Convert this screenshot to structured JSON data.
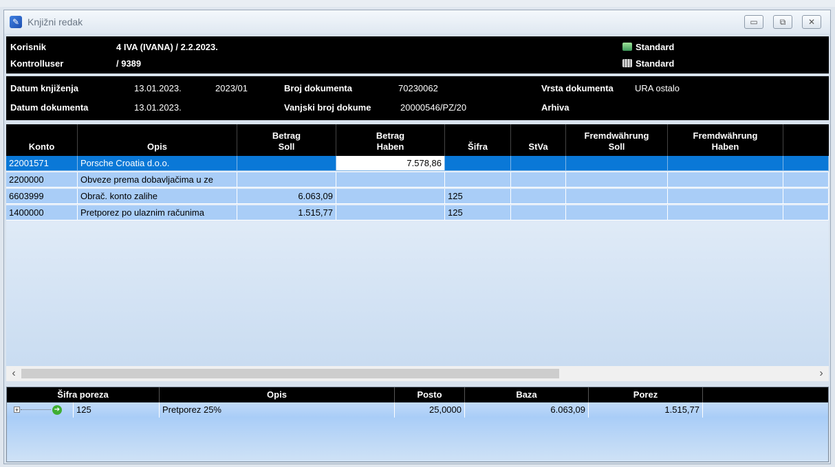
{
  "window": {
    "title": "Knjižni redak"
  },
  "header": {
    "korisnik_label": "Korisnik",
    "korisnik_value": "4 IVA (IVANA)  / 2.2.2023.",
    "kontroll_label": "Kontrolluser",
    "kontroll_value": "/ 9389",
    "standard1": "Standard",
    "standard2": "Standard",
    "datum_knjizenja_label": "Datum knjiženja",
    "datum_knjizenja_value": "13.01.2023.",
    "period_value": "2023/01",
    "broj_dokumenta_label": "Broj dokumenta",
    "broj_dokumenta_value": "70230062",
    "vrsta_label": "Vrsta dokumenta",
    "vrsta_value": "URA ostalo",
    "datum_dokumenta_label": "Datum dokumenta",
    "datum_dokumenta_value": "13.01.2023.",
    "vanjski_label": "Vanjski broj dokume",
    "vanjski_value": "20000546/PZ/20",
    "arhiva_label": "Arhiva"
  },
  "grid": {
    "columns": [
      {
        "line1": "",
        "line2": "Konto"
      },
      {
        "line1": "",
        "line2": "Opis"
      },
      {
        "line1": "Betrag",
        "line2": "Soll"
      },
      {
        "line1": "Betrag",
        "line2": "Haben"
      },
      {
        "line1": "",
        "line2": "Šifra"
      },
      {
        "line1": "",
        "line2": "StVa"
      },
      {
        "line1": "Fremdwährung",
        "line2": "Soll"
      },
      {
        "line1": "Fremdwährung",
        "line2": "Haben"
      },
      {
        "line1": "",
        "line2": ""
      }
    ],
    "rows": [
      {
        "konto": "22001571",
        "opis": "Porsche Croatia d.o.o.",
        "soll": "",
        "haben": "7.578,86",
        "sifra": "",
        "stva": "",
        "fsoll": "",
        "fhaben": "",
        "selected": true
      },
      {
        "konto": "2200000",
        "opis": "Obveze prema dobavljačima u ze",
        "soll": "",
        "haben": "",
        "sifra": "",
        "stva": "",
        "fsoll": "",
        "fhaben": "",
        "selected": false
      },
      {
        "konto": "6603999",
        "opis": "Obrač. konto zalihe",
        "soll": "6.063,09",
        "haben": "",
        "sifra": "125",
        "stva": "",
        "fsoll": "",
        "fhaben": "",
        "selected": false
      },
      {
        "konto": "1400000",
        "opis": "Pretporez po ulaznim računima",
        "soll": "1.515,77",
        "haben": "",
        "sifra": "125",
        "stva": "",
        "fsoll": "",
        "fhaben": "",
        "selected": false
      }
    ]
  },
  "scrollbar": {
    "left_arrow": "‹",
    "right_arrow": "›"
  },
  "tax": {
    "columns": [
      "Šifra poreza",
      "Opis",
      "Posto",
      "Baza",
      "Porez"
    ],
    "row": {
      "sifra": "125",
      "opis": "Pretporez 25%",
      "posto": "25,0000",
      "baza": "6.063,09",
      "porez": "1.515,77"
    }
  }
}
